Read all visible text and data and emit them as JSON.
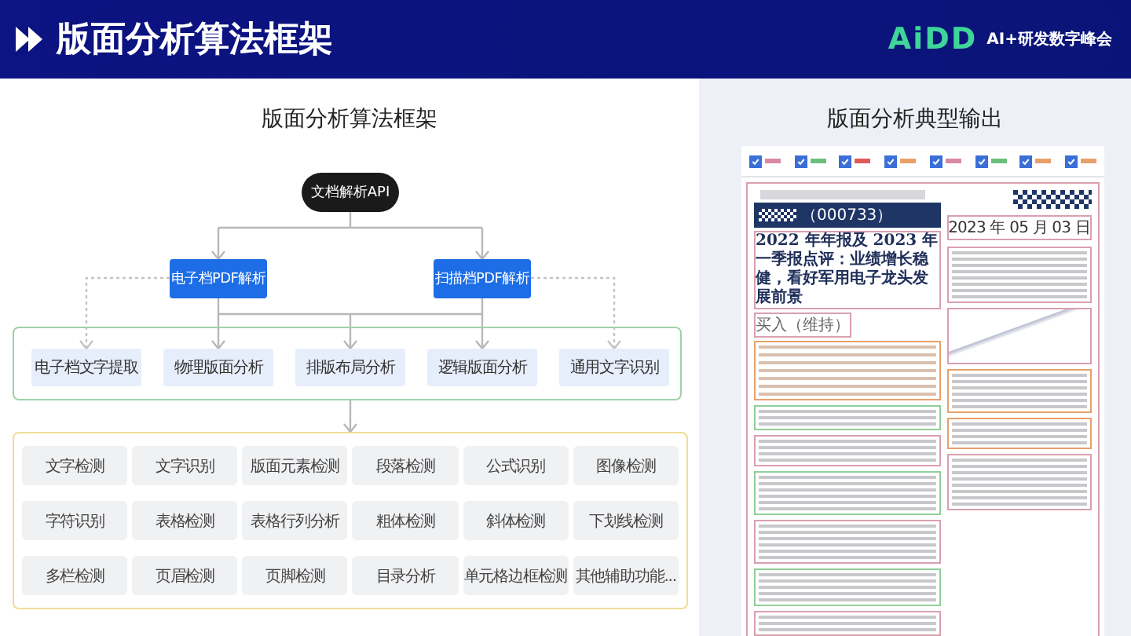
{
  "header": {
    "title": "版面分析算法框架",
    "logo": "AiDD",
    "event": "AI+研发数字峰会"
  },
  "framework": {
    "title": "版面分析算法框架",
    "api": "文档解析API",
    "parsers": [
      "电子档PDF解析",
      "扫描档PDF解析"
    ],
    "modules": [
      "电子档文字提取",
      "物理版面分析",
      "排版布局分析",
      "逻辑版面分析",
      "通用文字识别"
    ],
    "functions": [
      "文字检测",
      "文字识别",
      "版面元素检测",
      "段落检测",
      "公式识别",
      "图像检测",
      "字符识别",
      "表格检测",
      "表格行列分析",
      "粗体检测",
      "斜体检测",
      "下划线检测",
      "多栏检测",
      "页眉检测",
      "页脚检测",
      "目录分析",
      "单元格边框检测",
      "其他辅助功能..."
    ]
  },
  "output": {
    "title": "版面分析典型输出",
    "legend": [
      {
        "checked": true,
        "color": "#d98aa0"
      },
      {
        "checked": true,
        "color": "#6cbf7a"
      },
      {
        "checked": true,
        "color": "#e05a5a"
      },
      {
        "checked": true,
        "color": "#e8a06a"
      },
      {
        "checked": true,
        "color": "#d98aa0"
      },
      {
        "checked": true,
        "color": "#6cbf7a"
      },
      {
        "checked": true,
        "color": "#e8a06a"
      },
      {
        "checked": true,
        "color": "#e8a06a"
      }
    ],
    "document": {
      "code": "（000733）",
      "headline": "2022 年年报及 2023 年一季报点评：业绩增长稳健，看好军用电子龙头发展前景",
      "rating": "买入（维持）",
      "date": "2023 年 05 月 03 日"
    }
  }
}
